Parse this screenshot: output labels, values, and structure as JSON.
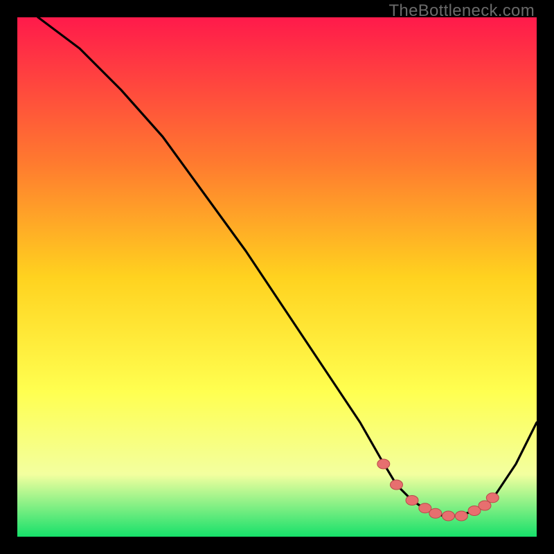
{
  "watermark": "TheBottleneck.com",
  "colors": {
    "gradient_top": "#ff1a4b",
    "gradient_mid_upper": "#ff7a2f",
    "gradient_mid": "#ffd21f",
    "gradient_mid_lower": "#ffff50",
    "gradient_lower": "#f3ff9f",
    "gradient_bottom": "#16e06a",
    "curve": "#000000",
    "marker_fill": "#e76f6f",
    "marker_stroke": "#b94a4a"
  },
  "chart_data": {
    "type": "line",
    "title": "",
    "xlabel": "",
    "ylabel": "",
    "xlim": [
      0,
      100
    ],
    "ylim": [
      0,
      100
    ],
    "grid": false,
    "series": [
      {
        "name": "bottleneck-curve",
        "x": [
          0,
          4,
          8,
          12,
          16,
          20,
          28,
          36,
          44,
          52,
          58,
          62,
          66,
          70,
          73,
          76,
          79,
          82,
          85,
          88,
          90,
          92,
          94,
          96,
          98,
          100
        ],
        "y": [
          105,
          100,
          97,
          94,
          90,
          86,
          77,
          66,
          55,
          43,
          34,
          28,
          22,
          15,
          10,
          7,
          5,
          4,
          4,
          5,
          6,
          8,
          11,
          14,
          18,
          22
        ]
      }
    ],
    "markers": {
      "name": "highlighted-points",
      "x": [
        70.5,
        73.0,
        76.0,
        78.5,
        80.5,
        83.0,
        85.5,
        88.0,
        90.0,
        91.5
      ],
      "y": [
        14.0,
        10.0,
        7.0,
        5.5,
        4.5,
        4.0,
        4.0,
        5.0,
        6.0,
        7.5
      ]
    }
  }
}
